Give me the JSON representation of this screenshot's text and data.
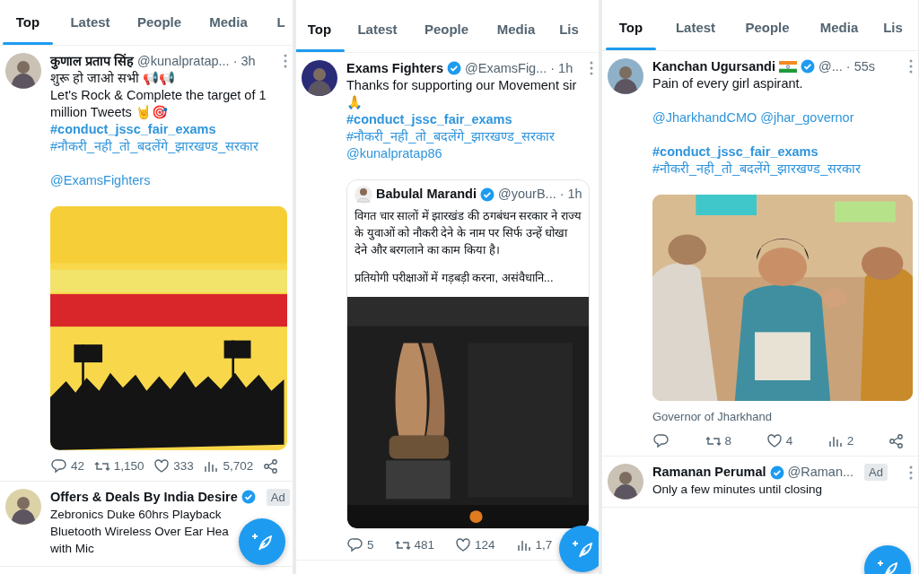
{
  "panels": [
    {
      "tabs": [
        {
          "label": "Top",
          "selected": true
        },
        {
          "label": "Latest",
          "selected": false
        },
        {
          "label": "People",
          "selected": false
        },
        {
          "label": "Media",
          "selected": false
        },
        {
          "label": "L",
          "selected": false
        }
      ],
      "tweets": [
        {
          "kind": "post",
          "name": "कुणाल प्रताप सिंह",
          "verified": false,
          "flag": false,
          "handle": "@kunalpratap...",
          "time": "· 3h",
          "paragraphs": [
            [
              {
                "kind": "text",
                "text": "शुरू हो जाओ सभी 📢📢"
              },
              {
                "kind": "text",
                "text": "Let's Rock & Complete the target of 1 million Tweets 🤘🎯"
              },
              {
                "kind": "hashtag",
                "bold": true,
                "text": "#conduct_jssc_fair_exams"
              },
              {
                "kind": "hashtag",
                "bold": false,
                "text": "#नौकरी_नही_तो_बदलेंगे_झारखण्ड_सरकार"
              }
            ],
            [
              {
                "kind": "mention",
                "text": "@ExamsFighters"
              }
            ]
          ],
          "media": {
            "kind": "picture"
          },
          "actions": [
            {
              "kind": "reply",
              "count": "42"
            },
            {
              "kind": "repost",
              "count": "1,150"
            },
            {
              "kind": "like",
              "count": "333"
            },
            {
              "kind": "views",
              "count": "5,702"
            },
            {
              "kind": "share"
            }
          ]
        },
        {
          "kind": "ad",
          "name": "Offers & Deals By India Desire",
          "verified": true,
          "flag": false,
          "ad": "Ad",
          "paragraphs": [
            [
              {
                "kind": "text",
                "text": "Zebronics Duke 60hrs Playback Bluetooth Wireless Over Ear Hea"
              },
              {
                "kind": "text",
                "text": "with Mic"
              }
            ]
          ]
        }
      ],
      "compose": true
    },
    {
      "tabs": [
        {
          "label": "Top",
          "selected": true
        },
        {
          "label": "Latest",
          "selected": false
        },
        {
          "label": "People",
          "selected": false
        },
        {
          "label": "Media",
          "selected": false
        },
        {
          "label": "Lis",
          "selected": false
        }
      ],
      "tweets": [
        {
          "kind": "post",
          "name": "Exams Fighters",
          "verified": true,
          "flag": false,
          "handle": "@ExamsFig...",
          "time": "· 1h",
          "paragraphs": [
            [
              {
                "kind": "text",
                "text": "Thanks for supporting our Movement sir 🙏"
              },
              {
                "kind": "hashtag",
                "bold": true,
                "text": "#conduct_jssc_fair_exams"
              },
              {
                "kind": "hashtag",
                "bold": false,
                "text": "#नौकरी_नही_तो_बदलेंगे_झारखण्ड_सरकार"
              },
              {
                "kind": "mention",
                "text": "@kunalpratap86"
              }
            ]
          ],
          "quote": {
            "name": "Babulal Marandi",
            "verified": true,
            "handle": "@yourB...",
            "time": "· 1h",
            "paragraphs": [
              [
                {
                  "kind": "text",
                  "text": "विगत चार सालों में झारखंड की ठगबंधन सरकार ने राज्य के युवाओं को नौकरी देने के नाम पर सिर्फ उन्हें धोखा देने और बरगलाने का काम किया है।"
                }
              ],
              [
                {
                  "kind": "text",
                  "text": "प्रतियोगी परीक्षाओं में गड़बड़ी करना, असंवैधानि..."
                }
              ]
            ],
            "media": {
              "kind": "picture"
            }
          },
          "actions": [
            {
              "kind": "reply",
              "count": "5"
            },
            {
              "kind": "repost",
              "count": "481"
            },
            {
              "kind": "like",
              "count": "124"
            },
            {
              "kind": "views",
              "count": "1,7"
            }
          ]
        }
      ],
      "compose": true
    },
    {
      "tabs": [
        {
          "label": "Top",
          "selected": true
        },
        {
          "label": "Latest",
          "selected": false
        },
        {
          "label": "People",
          "selected": false
        },
        {
          "label": "Media",
          "selected": false
        },
        {
          "label": "Lis",
          "selected": false
        }
      ],
      "tweets": [
        {
          "kind": "post",
          "name": "Kanchan Ugursandi",
          "verified": true,
          "flag": true,
          "handle": "@...",
          "time": "· 55s",
          "paragraphs": [
            [
              {
                "kind": "text",
                "text": "Pain of every girl aspirant."
              }
            ],
            [
              {
                "kind": "mention",
                "text": "@JharkhandCMO @jhar_governor"
              }
            ],
            [
              {
                "kind": "hashtag",
                "bold": true,
                "text": "#conduct_jssc_fair_exams"
              },
              {
                "kind": "hashtag",
                "bold": false,
                "text": "#नौकरी_नही_तो_बदलेंगे_झारखण्ड_सरकार"
              }
            ]
          ],
          "media": {
            "kind": "picture"
          },
          "caption": "Governor of Jharkhand",
          "actions": [
            {
              "kind": "reply"
            },
            {
              "kind": "repost",
              "count": "8"
            },
            {
              "kind": "like",
              "count": "4"
            },
            {
              "kind": "views",
              "count": "2"
            },
            {
              "kind": "share"
            }
          ]
        },
        {
          "kind": "ad",
          "name": "Ramanan Perumal",
          "verified": true,
          "flag": false,
          "handle": "@Raman...",
          "ad": "Ad",
          "paragraphs": [
            [
              {
                "kind": "text",
                "text": "Only a few minutes until closing"
              }
            ]
          ]
        }
      ],
      "compose": true
    }
  ]
}
